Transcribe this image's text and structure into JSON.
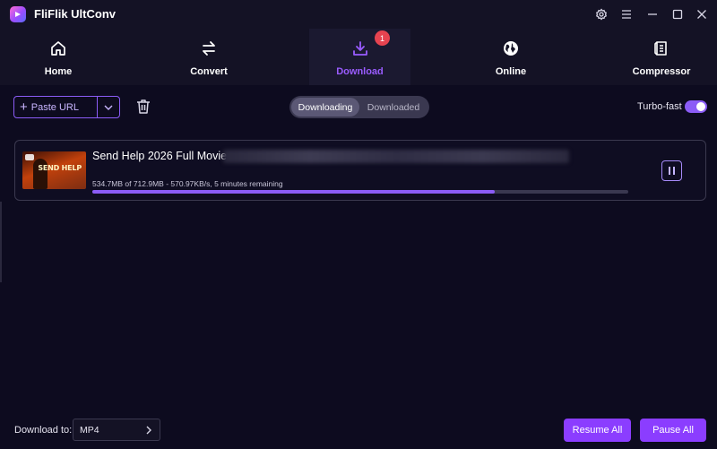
{
  "app": {
    "title": "FliFlik UltConv",
    "accent_color": "#8b5cf6",
    "background_color": "#0d0b1f"
  },
  "window_controls": [
    {
      "name": "settings-icon"
    },
    {
      "name": "menu-icon"
    },
    {
      "name": "minimize-icon"
    },
    {
      "name": "maximize-icon"
    },
    {
      "name": "close-icon"
    }
  ],
  "nav": {
    "items": [
      {
        "label": "Home",
        "icon": "home-icon"
      },
      {
        "label": "Convert",
        "icon": "convert-arrows-icon"
      },
      {
        "label": "Download",
        "icon": "download-icon",
        "active": true,
        "badge": "1"
      },
      {
        "label": "Online",
        "icon": "globe-icon"
      },
      {
        "label": "Compressor",
        "icon": "compressor-icon"
      }
    ]
  },
  "toolbar": {
    "paste_url_label": "Paste URL",
    "tabs": [
      "Downloading",
      "Downloaded"
    ],
    "active_tab": "Downloading",
    "turbo_label": "Turbo-fast",
    "turbo_enabled": true
  },
  "downloads": [
    {
      "title": "Send Help 2026 Full Movie",
      "thumbnail_text": "SEND HELP",
      "progress_text": "534.7MB of 712.9MB -  570.97KB/s, 5 minutes remaining",
      "progress_fraction": 0.75
    }
  ],
  "footer": {
    "download_to_label": "Download to:",
    "format_value": "MP4",
    "resume_all_label": "Resume All",
    "pause_all_label": "Pause All"
  }
}
